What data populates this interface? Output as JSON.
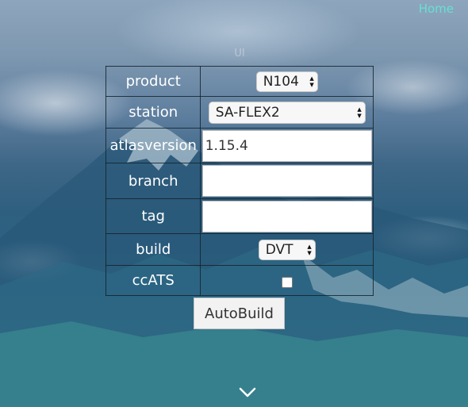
{
  "nav": {
    "home_label": "Home"
  },
  "page": {
    "title": "UI"
  },
  "form": {
    "rows": [
      {
        "label": "product",
        "type": "select",
        "value": "N104"
      },
      {
        "label": "station",
        "type": "select",
        "value": "SA-FLEX2"
      },
      {
        "label": "atlasversion",
        "type": "text",
        "value": "1.15.4"
      },
      {
        "label": "branch",
        "type": "text",
        "value": ""
      },
      {
        "label": "tag",
        "type": "text",
        "value": ""
      },
      {
        "label": "build",
        "type": "select",
        "value": "DVT"
      },
      {
        "label": "ccATS",
        "type": "checkbox",
        "checked": false
      }
    ],
    "submit_label": "AutoBuild"
  },
  "icons": {
    "scroll": "chevron-down-icon",
    "select": "select-arrows-icon"
  },
  "colors": {
    "link": "#66e0d2",
    "background_top": "#8ea6bd",
    "background_bottom": "#4b9c9a"
  }
}
